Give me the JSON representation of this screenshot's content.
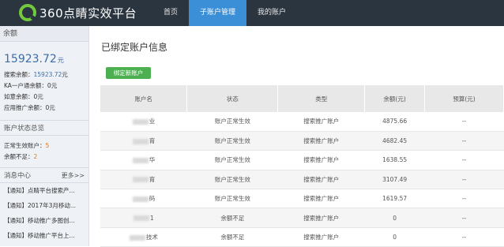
{
  "app": {
    "logo_text": "360点睛实效平台"
  },
  "nav": {
    "items": [
      "首页",
      "子账户管理",
      "我的账户"
    ],
    "active": 1
  },
  "sidebar": {
    "balance_head": "余额",
    "balance_value": "15923.72",
    "balance_unit": "元",
    "lines": [
      {
        "label": "搜索余额：",
        "value": "15923.72",
        "unit": "元"
      },
      {
        "label": "KA一户通余额：",
        "value": "0元"
      },
      {
        "label": "如意余额：",
        "value": "0元"
      },
      {
        "label": "应用推广余额：",
        "value": "0元"
      }
    ],
    "status_head": "账户状态总览",
    "status": [
      {
        "label": "正常生效账户：",
        "value": "5"
      },
      {
        "label": "余额不足：",
        "value": "2"
      }
    ],
    "news_head": "消息中心",
    "news_more": "更多>>",
    "news": [
      "【通知】点睛平台搜索产...",
      "【通知】2017年3月移动...",
      "【通知】移动推广多图创...",
      "【通知】移动推广平台上..."
    ]
  },
  "main": {
    "title": "已绑定账户信息",
    "bind_button": "绑定新账户",
    "columns": [
      "账户名",
      "状态",
      "类型",
      "余额(元)",
      "预算(元)"
    ],
    "rows": [
      {
        "name": "业",
        "status": "账户正常生效",
        "type": "搜索推广账户",
        "balance": "4875.66",
        "budget": "--"
      },
      {
        "name": "育",
        "status": "账户正常生效",
        "type": "搜索推广账户",
        "balance": "4682.45",
        "budget": "--"
      },
      {
        "name": "华",
        "status": "账户正常生效",
        "type": "搜索推广账户",
        "balance": "1638.55",
        "budget": "--"
      },
      {
        "name": "育",
        "status": "账户正常生效",
        "type": "搜索推广账户",
        "balance": "3107.49",
        "budget": "--"
      },
      {
        "name": "码",
        "status": "账户正常生效",
        "type": "搜索推广账户",
        "balance": "1619.57",
        "budget": "--"
      },
      {
        "name": "1",
        "status": "余额不足",
        "type": "搜索推广账户",
        "balance": "0",
        "budget": "--"
      },
      {
        "name": "技术",
        "status": "余额不足",
        "type": "搜索推广账户",
        "balance": "0",
        "budget": "--"
      }
    ]
  }
}
